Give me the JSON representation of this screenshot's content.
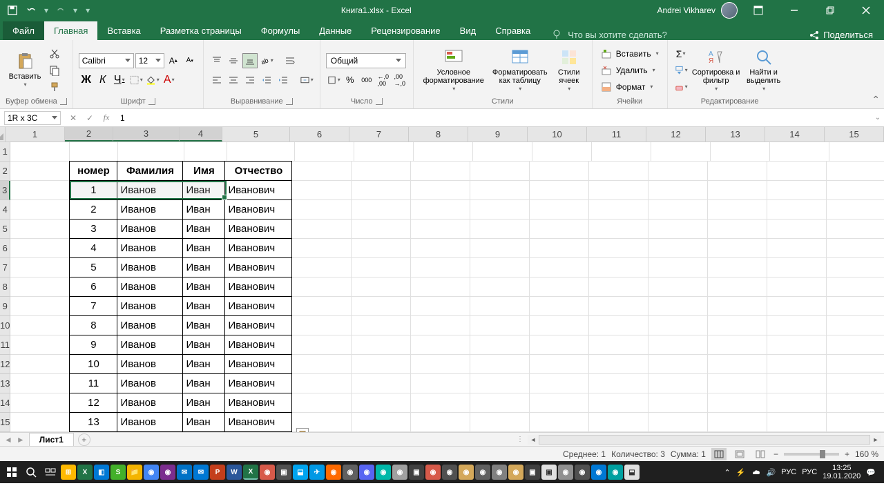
{
  "title": "Книга1.xlsx - Excel",
  "user": "Andrei Vikharev",
  "tabs": {
    "file": "Файл",
    "home": "Главная",
    "insert": "Вставка",
    "layout": "Разметка страницы",
    "formulas": "Формулы",
    "data": "Данные",
    "review": "Рецензирование",
    "view": "Вид",
    "help": "Справка",
    "tellme": "Что вы хотите сделать?",
    "share": "Поделиться"
  },
  "ribbon": {
    "clipboard": {
      "paste": "Вставить",
      "label": "Буфер обмена"
    },
    "font": {
      "name": "Calibri",
      "size": "12",
      "label": "Шрифт"
    },
    "alignment": {
      "label": "Выравнивание"
    },
    "number": {
      "format": "Общий",
      "label": "Число"
    },
    "styles": {
      "cond": "Условное форматирование",
      "table": "Форматировать как таблицу",
      "cell": "Стили ячеек",
      "label": "Стили"
    },
    "cells": {
      "insert": "Вставить",
      "delete": "Удалить",
      "format": "Формат",
      "label": "Ячейки"
    },
    "editing": {
      "sort": "Сортировка и фильтр",
      "find": "Найти и выделить",
      "label": "Редактирование"
    }
  },
  "namebox": "1R x 3C",
  "formula": "1",
  "columns": [
    {
      "n": "1",
      "w": 86
    },
    {
      "n": "2",
      "w": 70
    },
    {
      "n": "3",
      "w": 96
    },
    {
      "n": "4",
      "w": 62
    },
    {
      "n": "5",
      "w": 98
    },
    {
      "n": "6",
      "w": 86
    },
    {
      "n": "7",
      "w": 86
    },
    {
      "n": "8",
      "w": 86
    },
    {
      "n": "9",
      "w": 86
    },
    {
      "n": "10",
      "w": 86
    },
    {
      "n": "11",
      "w": 86
    },
    {
      "n": "12",
      "w": 86
    },
    {
      "n": "13",
      "w": 86
    },
    {
      "n": "14",
      "w": 86
    },
    {
      "n": "15",
      "w": 86
    }
  ],
  "rows": [
    "1",
    "2",
    "3",
    "4",
    "5",
    "6",
    "7",
    "8",
    "9",
    "10",
    "11",
    "12",
    "13",
    "14",
    "15"
  ],
  "table": {
    "headers": [
      "номер",
      "Фамилия",
      "Имя",
      "Отчество"
    ],
    "data": [
      [
        "1",
        "Иванов",
        "Иван",
        "Иванович"
      ],
      [
        "2",
        "Иванов",
        "Иван",
        "Иванович"
      ],
      [
        "3",
        "Иванов",
        "Иван",
        "Иванович"
      ],
      [
        "4",
        "Иванов",
        "Иван",
        "Иванович"
      ],
      [
        "5",
        "Иванов",
        "Иван",
        "Иванович"
      ],
      [
        "6",
        "Иванов",
        "Иван",
        "Иванович"
      ],
      [
        "7",
        "Иванов",
        "Иван",
        "Иванович"
      ],
      [
        "8",
        "Иванов",
        "Иван",
        "Иванович"
      ],
      [
        "9",
        "Иванов",
        "Иван",
        "Иванович"
      ],
      [
        "10",
        "Иванов",
        "Иван",
        "Иванович"
      ],
      [
        "11",
        "Иванов",
        "Иван",
        "Иванович"
      ],
      [
        "12",
        "Иванов",
        "Иван",
        "Иванович"
      ],
      [
        "13",
        "Иванов",
        "Иван",
        "Иванович"
      ]
    ]
  },
  "sheet": "Лист1",
  "status": {
    "avg": "Среднее: 1",
    "count": "Количество: 3",
    "sum": "Сумма: 1",
    "zoom": "160 %"
  },
  "tray": {
    "lang1": "РУС",
    "lang2": "РУС",
    "time": "13:25",
    "date": "19.01.2020"
  }
}
